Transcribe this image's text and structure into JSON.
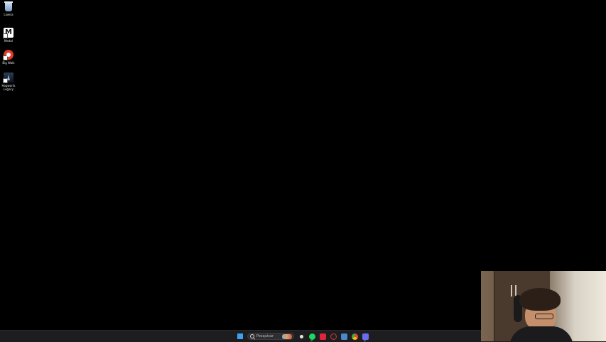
{
  "desktop": {
    "icons": [
      {
        "label": "Lixeira",
        "icon": "recycle-bin-icon"
      },
      {
        "label": "Medal",
        "icon": "medal-icon"
      },
      {
        "label": "Big Walk",
        "icon": "big-walk-icon"
      },
      {
        "label": "Hogwarts Legacy",
        "icon": "hogwarts-legacy-icon"
      }
    ]
  },
  "taskbar": {
    "search_placeholder": "Pesquisar",
    "apps": [
      {
        "name": "start-menu",
        "color": "#3aa0f0"
      },
      {
        "name": "steam-app",
        "color": "#e6e6e6"
      },
      {
        "name": "spotify-app",
        "color": "#1ed760"
      },
      {
        "name": "red-app",
        "color": "#e0243a"
      },
      {
        "name": "discord-app",
        "color": "#c03a3a"
      },
      {
        "name": "steam-blue-app",
        "color": "#4b88c7"
      },
      {
        "name": "chrome-app",
        "color": "#f4c20d"
      },
      {
        "name": "gallery-app",
        "color": "#6a6cf0"
      }
    ]
  },
  "webcam": {
    "description": ""
  }
}
